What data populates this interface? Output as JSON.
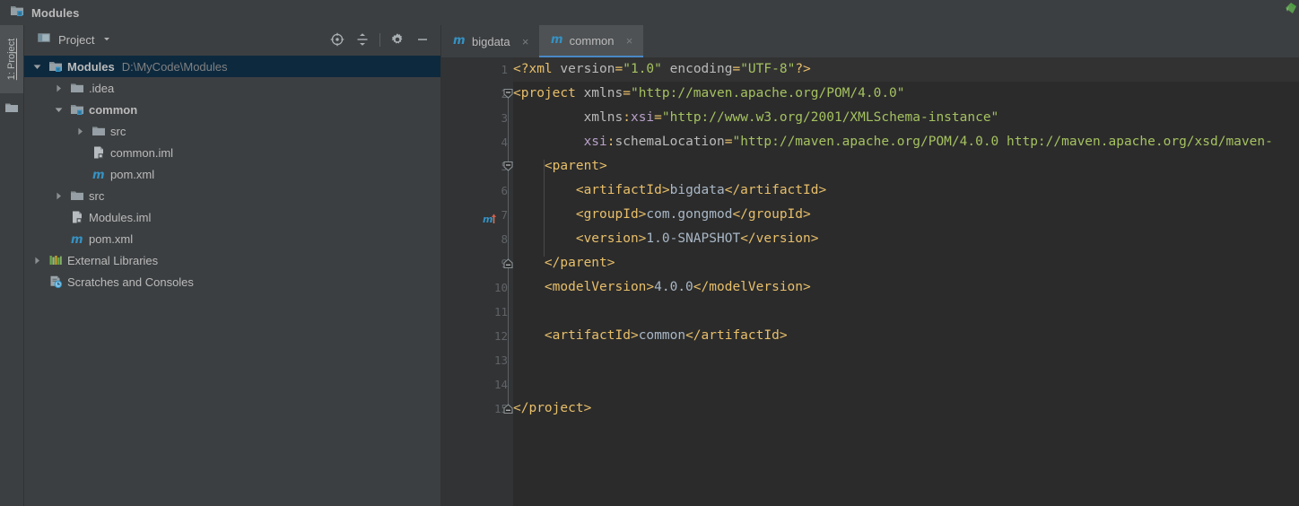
{
  "window": {
    "title": "Modules",
    "title_icon": "module-folder-icon"
  },
  "toolstrip": {
    "project_button_label": "1: Project",
    "folder_icon": "folder-icon"
  },
  "project_panel": {
    "header": {
      "title": "Project",
      "view_icon": "project-view-icon",
      "caret_icon": "chevron-down-icon",
      "actions": [
        {
          "name": "locate-icon",
          "glyph": "locate"
        },
        {
          "name": "collapse-all-icon",
          "glyph": "collapse"
        },
        {
          "name": "gear-icon",
          "glyph": "gear"
        },
        {
          "name": "minimize-icon",
          "glyph": "minimize"
        }
      ]
    },
    "tree": [
      {
        "label": "Modules",
        "path": "D:\\MyCode\\Modules",
        "icon": "module-folder-icon",
        "arrow": "expanded",
        "indent": 0,
        "bold": true,
        "selected": true
      },
      {
        "label": ".idea",
        "path": "",
        "icon": "folder-icon",
        "arrow": "collapsed",
        "indent": 1,
        "bold": false,
        "selected": false
      },
      {
        "label": "common",
        "path": "",
        "icon": "module-folder-icon",
        "arrow": "expanded",
        "indent": 1,
        "bold": true,
        "selected": false
      },
      {
        "label": "src",
        "path": "",
        "icon": "folder-icon",
        "arrow": "collapsed",
        "indent": 2,
        "bold": false,
        "selected": false
      },
      {
        "label": "common.iml",
        "path": "",
        "icon": "iml-file-icon",
        "arrow": "none",
        "indent": 2,
        "bold": false,
        "selected": false
      },
      {
        "label": "pom.xml",
        "path": "",
        "icon": "maven-icon",
        "arrow": "none",
        "indent": 2,
        "bold": false,
        "selected": false
      },
      {
        "label": "src",
        "path": "",
        "icon": "folder-icon",
        "arrow": "collapsed",
        "indent": 1,
        "bold": false,
        "selected": false
      },
      {
        "label": "Modules.iml",
        "path": "",
        "icon": "iml-file-icon",
        "arrow": "none",
        "indent": 1,
        "bold": false,
        "selected": false
      },
      {
        "label": "pom.xml",
        "path": "",
        "icon": "maven-icon",
        "arrow": "none",
        "indent": 1,
        "bold": false,
        "selected": false
      },
      {
        "label": "External Libraries",
        "path": "",
        "icon": "library-icon",
        "arrow": "collapsed",
        "indent": 0,
        "bold": false,
        "selected": false
      },
      {
        "label": "Scratches and Consoles",
        "path": "",
        "icon": "scratches-icon",
        "arrow": "none",
        "indent": 0,
        "bold": false,
        "selected": false
      }
    ]
  },
  "editor": {
    "tabs": [
      {
        "label": "bigdata",
        "icon": "maven-icon",
        "close_glyph": "×",
        "active": false
      },
      {
        "label": "common",
        "icon": "maven-icon",
        "close_glyph": "×",
        "active": true
      }
    ],
    "line_numbers": [
      "1",
      "2",
      "3",
      "4",
      "5",
      "6",
      "7",
      "8",
      "9",
      "10",
      "11",
      "12",
      "13",
      "14",
      "15"
    ],
    "caret_line": 1,
    "run_marker_line": 5,
    "run_marker_icon": "maven-run-icon",
    "fold_markers": [
      {
        "line": 2,
        "type": "open"
      },
      {
        "line": 5,
        "type": "open"
      },
      {
        "line": 9,
        "type": "close"
      },
      {
        "line": 15,
        "type": "close"
      }
    ],
    "code_lines": [
      {
        "n": 1,
        "tokens": [
          {
            "t": "<?xml ",
            "c": "k-proc"
          },
          {
            "t": "version",
            "c": "k-attr"
          },
          {
            "t": "=",
            "c": "k-punct"
          },
          {
            "t": "\"1.0\"",
            "c": "k-attrv"
          },
          {
            "t": " ",
            "c": "k-text"
          },
          {
            "t": "encoding",
            "c": "k-attr"
          },
          {
            "t": "=",
            "c": "k-punct"
          },
          {
            "t": "\"UTF-8\"",
            "c": "k-attrv"
          },
          {
            "t": "?>",
            "c": "k-proc"
          }
        ]
      },
      {
        "n": 2,
        "tokens": [
          {
            "t": "<",
            "c": "k-tag"
          },
          {
            "t": "project",
            "c": "k-tag"
          },
          {
            "t": " ",
            "c": "k-text"
          },
          {
            "t": "xmlns",
            "c": "k-attr"
          },
          {
            "t": "=",
            "c": "k-punct"
          },
          {
            "t": "\"http://maven.apache.org/POM/4.0.0\"",
            "c": "k-attrv"
          }
        ]
      },
      {
        "n": 3,
        "tokens": [
          {
            "t": "         ",
            "c": "k-text"
          },
          {
            "t": "xmlns",
            "c": "k-attr"
          },
          {
            "t": ":",
            "c": "k-punct"
          },
          {
            "t": "xsi",
            "c": "k-ns"
          },
          {
            "t": "=",
            "c": "k-punct"
          },
          {
            "t": "\"http://www.w3.org/2001/XMLSchema-instance\"",
            "c": "k-attrv"
          }
        ]
      },
      {
        "n": 4,
        "tokens": [
          {
            "t": "         ",
            "c": "k-text"
          },
          {
            "t": "xsi",
            "c": "k-ns"
          },
          {
            "t": ":",
            "c": "k-punct"
          },
          {
            "t": "schemaLocation",
            "c": "k-attr"
          },
          {
            "t": "=",
            "c": "k-punct"
          },
          {
            "t": "\"http://maven.apache.org/POM/4.0.0 http://maven.apache.org/xsd/maven-",
            "c": "k-attrv"
          }
        ]
      },
      {
        "n": 5,
        "tokens": [
          {
            "t": "    ",
            "c": "k-text"
          },
          {
            "t": "<parent>",
            "c": "k-tag"
          }
        ]
      },
      {
        "n": 6,
        "tokens": [
          {
            "t": "        ",
            "c": "k-text"
          },
          {
            "t": "<artifactId>",
            "c": "k-tag"
          },
          {
            "t": "bigdata",
            "c": "k-text"
          },
          {
            "t": "</artifactId>",
            "c": "k-tag"
          }
        ]
      },
      {
        "n": 7,
        "tokens": [
          {
            "t": "        ",
            "c": "k-text"
          },
          {
            "t": "<groupId>",
            "c": "k-tag"
          },
          {
            "t": "com.gongmod",
            "c": "k-text"
          },
          {
            "t": "</groupId>",
            "c": "k-tag"
          }
        ]
      },
      {
        "n": 8,
        "tokens": [
          {
            "t": "        ",
            "c": "k-text"
          },
          {
            "t": "<version>",
            "c": "k-tag"
          },
          {
            "t": "1.0-SNAPSHOT",
            "c": "k-text"
          },
          {
            "t": "</version>",
            "c": "k-tag"
          }
        ]
      },
      {
        "n": 9,
        "tokens": [
          {
            "t": "    ",
            "c": "k-text"
          },
          {
            "t": "</parent>",
            "c": "k-tag"
          }
        ]
      },
      {
        "n": 10,
        "tokens": [
          {
            "t": "    ",
            "c": "k-text"
          },
          {
            "t": "<modelVersion>",
            "c": "k-tag"
          },
          {
            "t": "4.0.0",
            "c": "k-text"
          },
          {
            "t": "</modelVersion>",
            "c": "k-tag"
          }
        ]
      },
      {
        "n": 11,
        "tokens": [
          {
            "t": "",
            "c": "k-text"
          }
        ]
      },
      {
        "n": 12,
        "tokens": [
          {
            "t": "    ",
            "c": "k-text"
          },
          {
            "t": "<artifactId>",
            "c": "k-tag"
          },
          {
            "t": "common",
            "c": "k-text"
          },
          {
            "t": "</artifactId>",
            "c": "k-tag"
          }
        ]
      },
      {
        "n": 13,
        "tokens": [
          {
            "t": "",
            "c": "k-text"
          }
        ]
      },
      {
        "n": 14,
        "tokens": [
          {
            "t": "",
            "c": "k-text"
          }
        ]
      },
      {
        "n": 15,
        "tokens": [
          {
            "t": "</project>",
            "c": "k-tag"
          }
        ]
      }
    ]
  },
  "colors": {
    "panel_bg": "#3c3f41",
    "editor_bg": "#2b2b2b",
    "gutter_bg": "#313335",
    "selection_bg": "#0d293e",
    "tab_active_bg": "#4e5254",
    "tab_underline": "#4a88c7",
    "text": "#bbbbbb",
    "tag": "#e8bf6a",
    "attr_value": "#a5c261",
    "namespace": "#b8a0c9",
    "plain_text": "#a9b7c6",
    "line_number": "#606366"
  }
}
